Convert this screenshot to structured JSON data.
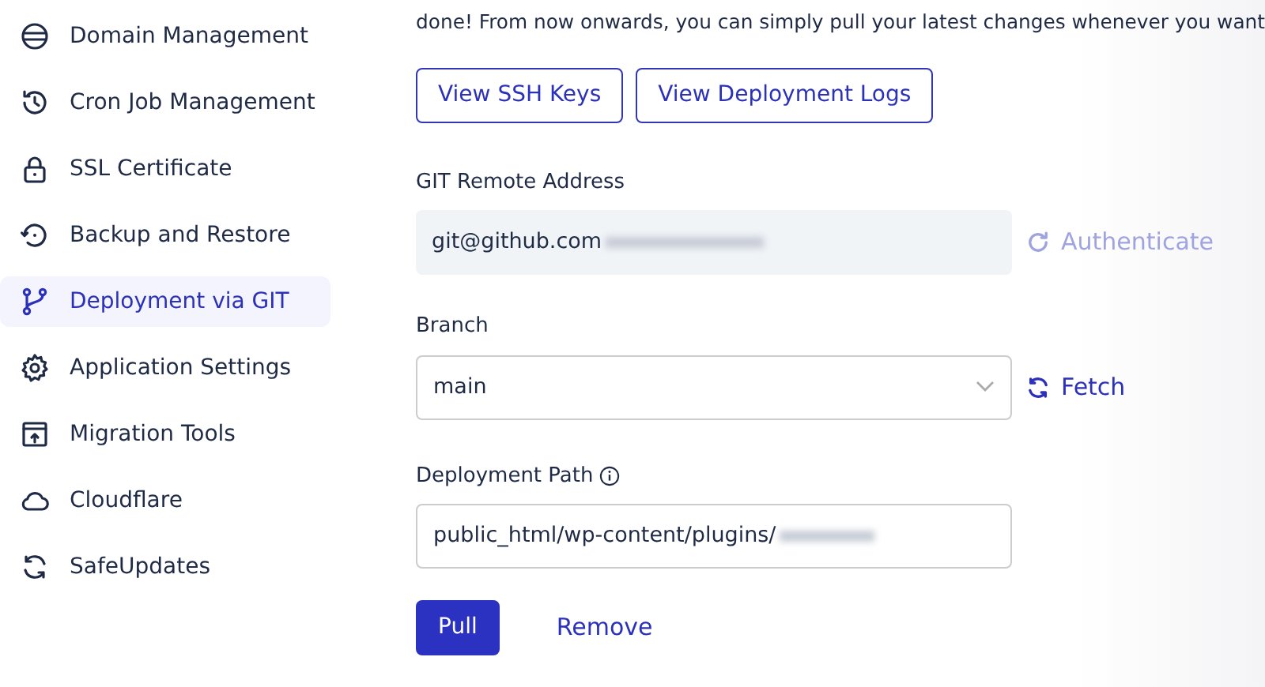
{
  "sidebar": {
    "items": [
      {
        "label": "Domain Management",
        "selected": false
      },
      {
        "label": "Cron Job Management",
        "selected": false
      },
      {
        "label": "SSL Certificate",
        "selected": false
      },
      {
        "label": "Backup and Restore",
        "selected": false
      },
      {
        "label": "Deployment via GIT",
        "selected": true
      },
      {
        "label": "Application Settings",
        "selected": false
      },
      {
        "label": "Migration Tools",
        "selected": false
      },
      {
        "label": "Cloudflare",
        "selected": false
      },
      {
        "label": "SafeUpdates",
        "selected": false
      }
    ]
  },
  "intro_text": "done! From now onwards, you can simply pull your latest changes whenever you want",
  "top_buttons": [
    "View SSH Keys",
    "View Deployment Logs"
  ],
  "remote": {
    "label": "GIT Remote Address",
    "value": "git@github.com",
    "action": {
      "label": "Authenticate",
      "disabled": true
    }
  },
  "branch": {
    "label": "Branch",
    "value": "main",
    "action": {
      "label": "Fetch",
      "disabled": false
    }
  },
  "path": {
    "label": "Deployment Path",
    "value": "public_html/wp-content/plugins/"
  },
  "actions": [
    "Pull",
    "Remove"
  ]
}
